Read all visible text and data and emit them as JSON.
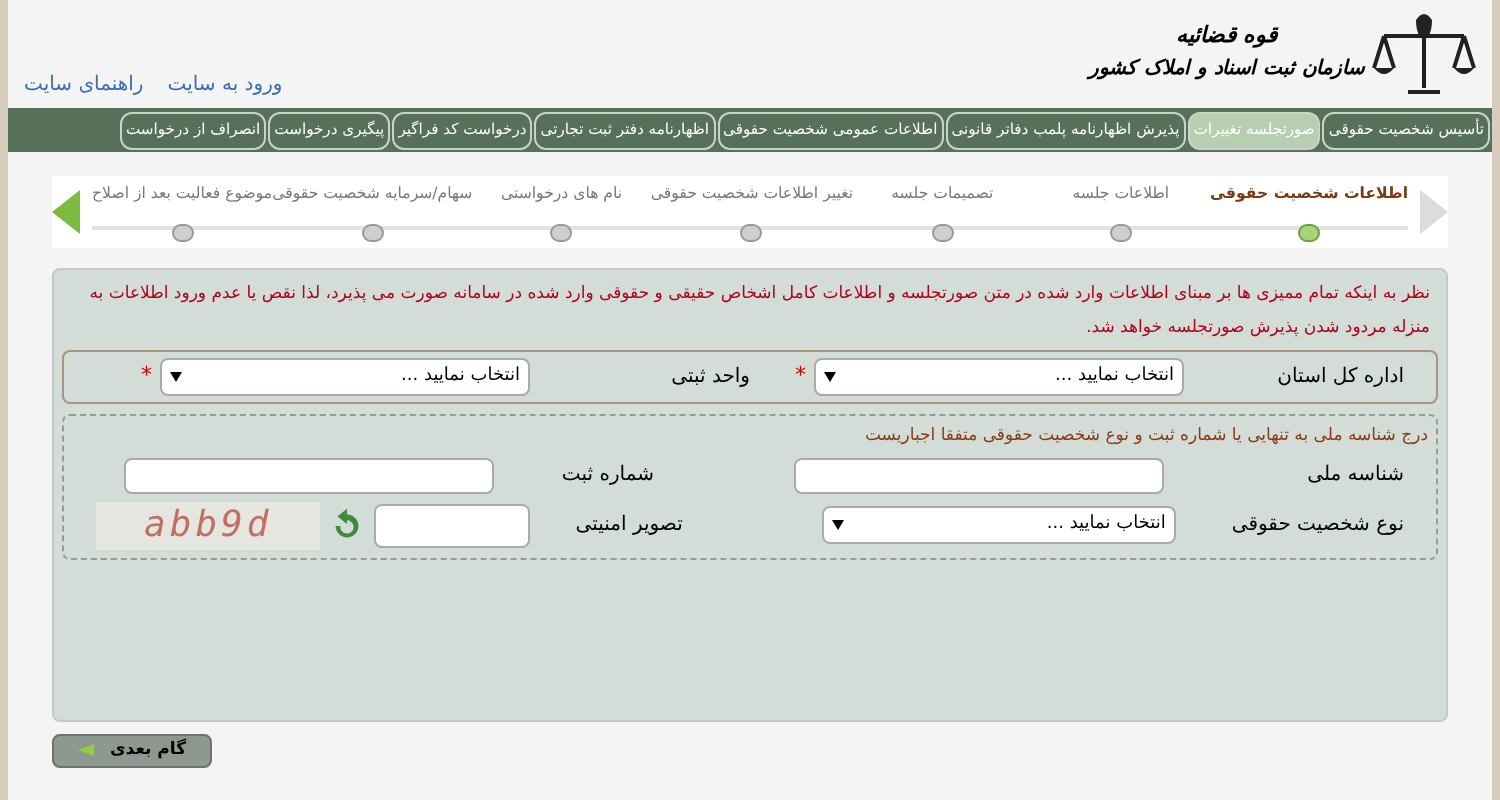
{
  "header": {
    "org_title": "قوه قضائیه",
    "org_subtitle": "سازمان ثبت اسناد و املاک کشور",
    "links": [
      "ورود به سایت",
      "راهنمای سایت"
    ]
  },
  "nav": [
    {
      "label": "تأسیس شخصیت حقوقی",
      "selected": false
    },
    {
      "label": "صورتجلسه تغییرات",
      "selected": true
    },
    {
      "label": "پذیرش اظهارنامه پلمب دفاتر قانونی",
      "selected": false
    },
    {
      "label": "اطلاعات عمومی شخصیت حقوقی",
      "selected": false
    },
    {
      "label": "اظهارنامه دفتر ثبت تجارتی",
      "selected": false
    },
    {
      "label": "درخواست کد فراگیر",
      "selected": false
    },
    {
      "label": "پیگیری درخواست",
      "selected": false
    },
    {
      "label": "انصراف از درخواست",
      "selected": false
    }
  ],
  "steps": [
    {
      "label": "اطلاعات شخصیت حقوقی",
      "selected": true
    },
    {
      "label": "اطلاعات جلسه",
      "selected": false
    },
    {
      "label": "تصمیمات جلسه",
      "selected": false
    },
    {
      "label": "تغییر اطلاعات شخصیت حقوقی",
      "selected": false
    },
    {
      "label": "نام های درخواستی",
      "selected": false
    },
    {
      "label": "سهام/سرمایه شخصیت حقوقی",
      "selected": false
    },
    {
      "label": "موضوع فعالیت بعد از اصلاح",
      "selected": false
    }
  ],
  "notice": "نظر به اینکه تمام ممیزی ها بر مبنای اطلاعات وارد شده در متن صورتجلسه و اطلاعات کامل اشخاص حقیقی و حقوقی وارد شده در سامانه صورت می پذیرد، لذا نقص یا عدم ورود اطلاعات به منزله مردود شدن پذیرش صورتجلسه خواهد شد.",
  "office_fields": [
    {
      "label": "اداره کل استان",
      "value": "انتخاب نمایید ...",
      "required": true
    },
    {
      "label": "واحد ثبتی",
      "value": "انتخاب نمایید ...",
      "required": true
    }
  ],
  "identity": {
    "hint": "درج شناسه ملی به تنهایی یا شماره ثبت و نوع شخصیت حقوقی متفقا اجباریست",
    "national_id": {
      "label": "شناسه ملی"
    },
    "reg_number": {
      "label": "شماره ثبت"
    },
    "entity_type": {
      "label": "نوع شخصیت حقوقی",
      "value": "انتخاب نمایید ..."
    },
    "captcha": {
      "label": "تصویر امنیتی",
      "code": "abb9d"
    }
  },
  "required_mark": "*",
  "next_button": "گام بعدی"
}
